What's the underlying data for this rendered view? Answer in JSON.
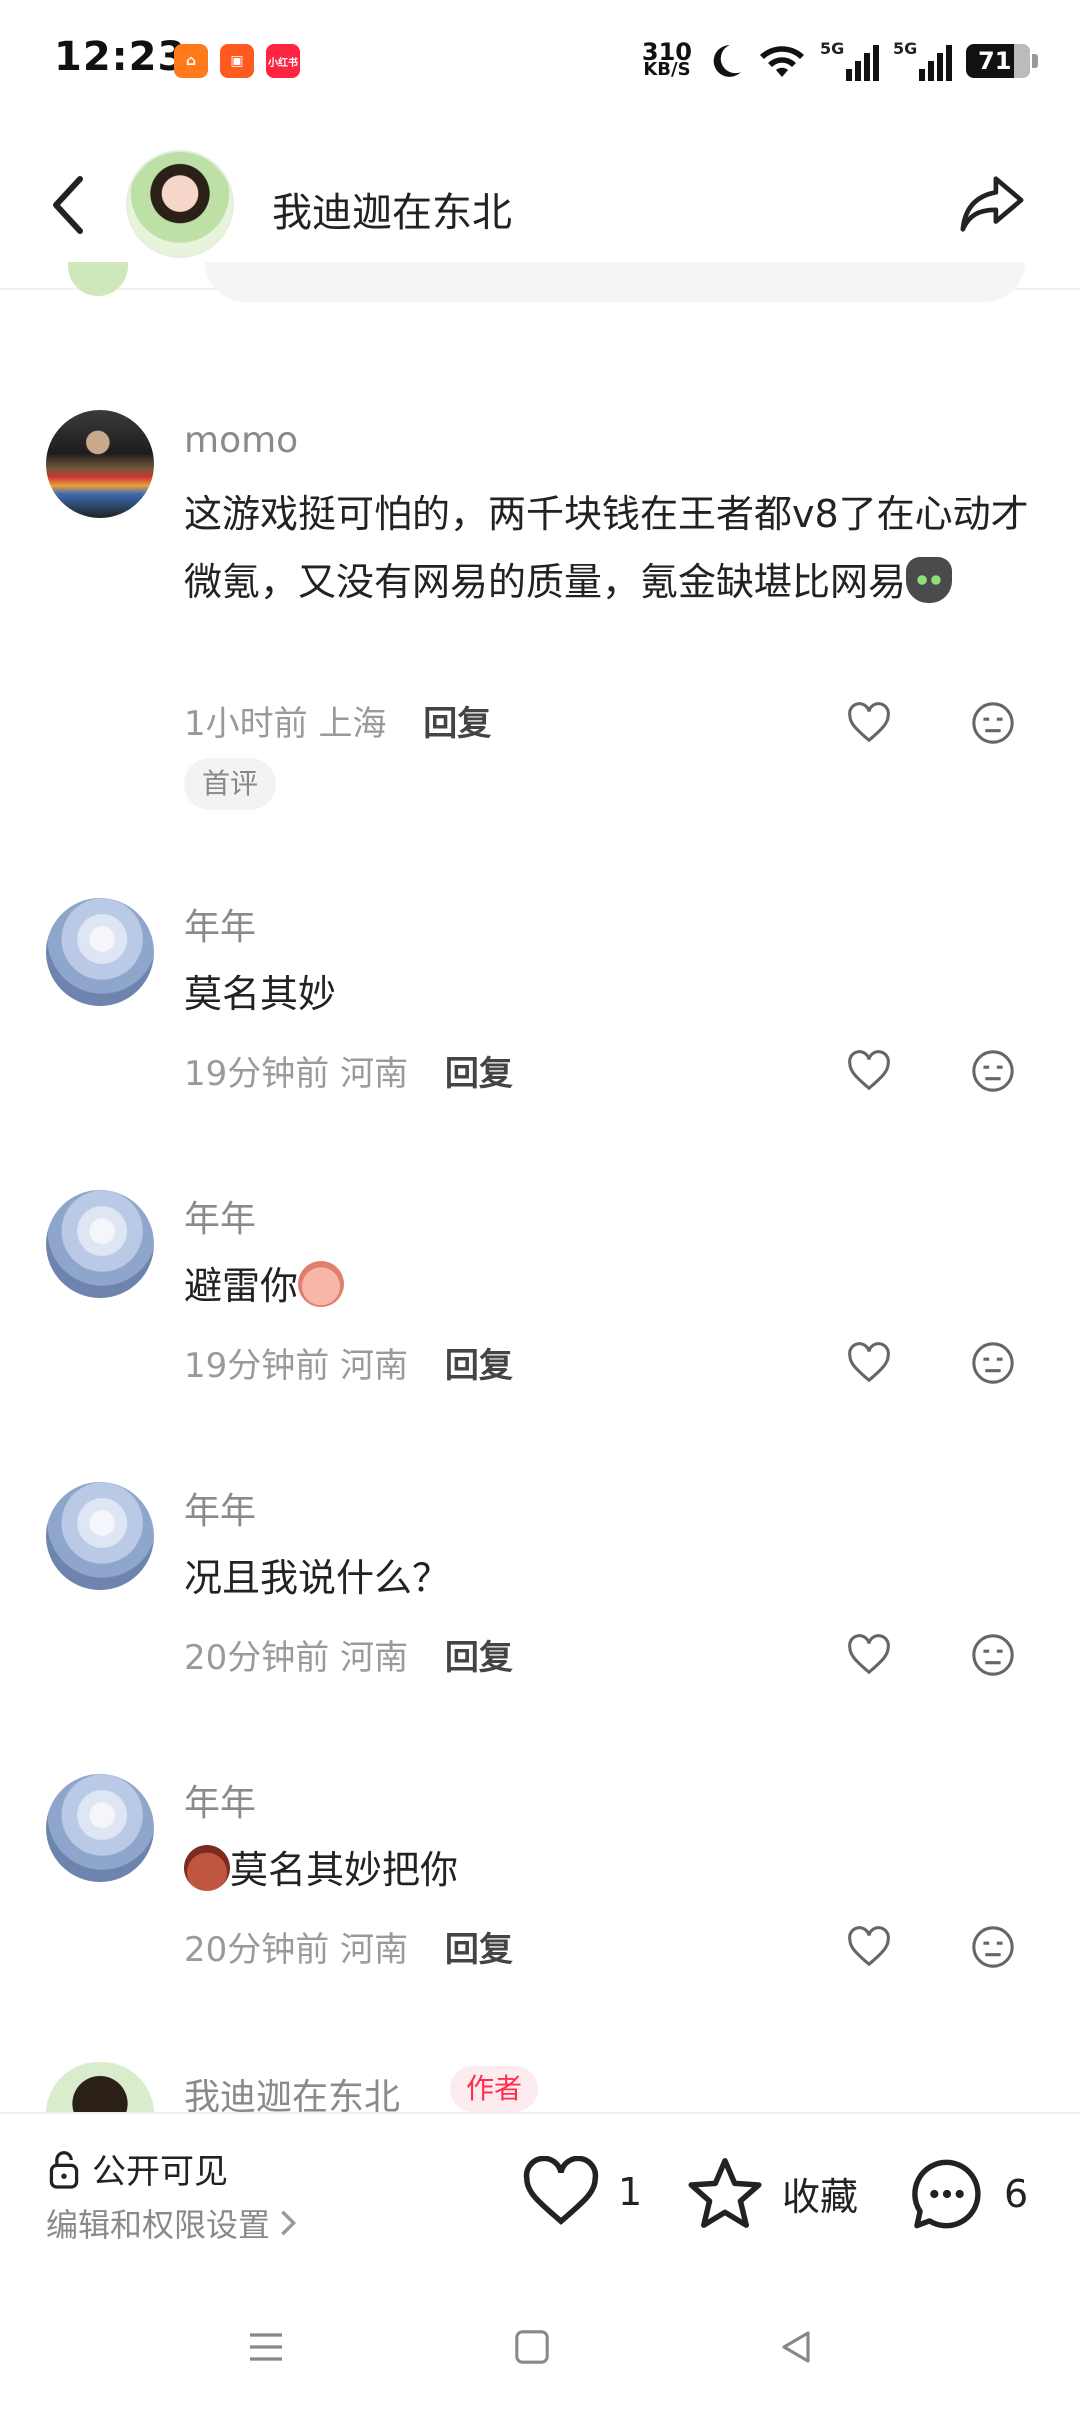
{
  "status": {
    "time": "12:23",
    "net_speed_value": "310",
    "net_speed_unit": "KB/S",
    "signal_1": "5G",
    "signal_2": "5G",
    "battery": "71",
    "app_badge_3": "小红书"
  },
  "header": {
    "author_name": "我迪迦在东北"
  },
  "comments": [
    {
      "user": "momo",
      "text": "这游戏挺可怕的，两千块钱在王者都v8了在心动才微氪，又没有网易的质量，氪金缺堪比网易",
      "time": "1小时前",
      "location": "上海",
      "reply_label": "回复",
      "tag": "首评"
    },
    {
      "user": "年年",
      "text": "莫名其妙",
      "time": "19分钟前",
      "location": "河南",
      "reply_label": "回复"
    },
    {
      "user": "年年",
      "text": "避雷你",
      "time": "19分钟前",
      "location": "河南",
      "reply_label": "回复"
    },
    {
      "user": "年年",
      "text": "况且我说什么？",
      "time": "20分钟前",
      "location": "河南",
      "reply_label": "回复"
    },
    {
      "user": "年年",
      "text": "莫名其妙把你",
      "time": "20分钟前",
      "location": "河南",
      "reply_label": "回复"
    }
  ],
  "author_reply": {
    "user": "我迪迦在东北",
    "tag": "作者"
  },
  "bottom": {
    "visibility": "公开可见",
    "permissions_link": "编辑和权限设置",
    "likes": "1",
    "collect_label": "收藏",
    "comments_count": "6"
  },
  "icons": {
    "back": "back-arrow-icon",
    "share": "share-icon",
    "like": "heart-icon",
    "dislike": "meh-face-icon",
    "lock": "lock-icon",
    "star": "star-icon",
    "comment": "comment-bubble-icon"
  },
  "colors": {
    "author_tag": "#ff2e4d",
    "secondary_text": "#8a8a8a"
  }
}
